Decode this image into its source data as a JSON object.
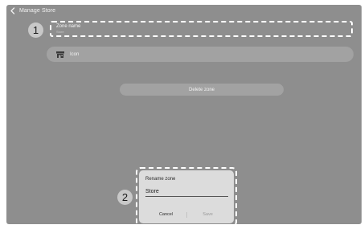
{
  "header": {
    "back_icon": "chevron-left-icon",
    "title": "Manage Store"
  },
  "steps": [
    "1",
    "2"
  ],
  "zone_name": {
    "label": "Zone name",
    "value": "Store"
  },
  "icon_row": {
    "icon": "storefront-icon",
    "label": "Icon"
  },
  "delete_button": {
    "label": "Delete zone"
  },
  "rename_dialog": {
    "title": "Rename zone",
    "input_value": "Store",
    "cancel_label": "Cancel",
    "save_label": "Save"
  },
  "colors": {
    "screen_background": "#8e8e8e",
    "highlight_outline": "#ffffff",
    "dialog_background": "#dcdcdc"
  }
}
